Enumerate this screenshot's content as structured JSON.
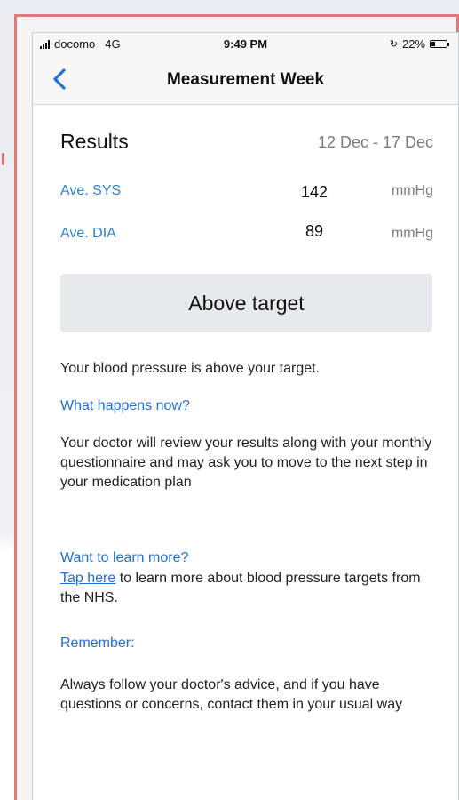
{
  "status_bar": {
    "carrier": "docomo",
    "network": "4G",
    "time": "9:49 PM",
    "battery_text": "22%",
    "battery_level": 0.22
  },
  "nav": {
    "title": "Measurement Week"
  },
  "results": {
    "title": "Results",
    "date_range": "12 Dec - 17 Dec",
    "metrics": [
      {
        "label": "Ave. SYS",
        "value": "142",
        "unit": "mmHg"
      },
      {
        "label": "Ave. DIA",
        "value": "89",
        "unit": "mmHg"
      }
    ],
    "status_label": "Above target"
  },
  "info": {
    "summary": "Your blood pressure is above your target.",
    "what_happens_heading": "What happens now?",
    "what_happens_text": "Your doctor will review your results along with your monthly questionnaire and may ask you to move to the next step in your medication plan",
    "learn_more_heading": "Want to learn more?",
    "learn_more_link": "Tap here",
    "learn_more_text": " to learn more about blood pressure targets from the NHS.",
    "remember_heading": "Remember:",
    "remember_text": "Always follow your doctor's advice, and if you have questions or concerns, contact them in your usual way"
  },
  "colors": {
    "accent": "#1f6fd6",
    "frame_border": "#e4777b",
    "status_box": "#e8e9ec"
  }
}
